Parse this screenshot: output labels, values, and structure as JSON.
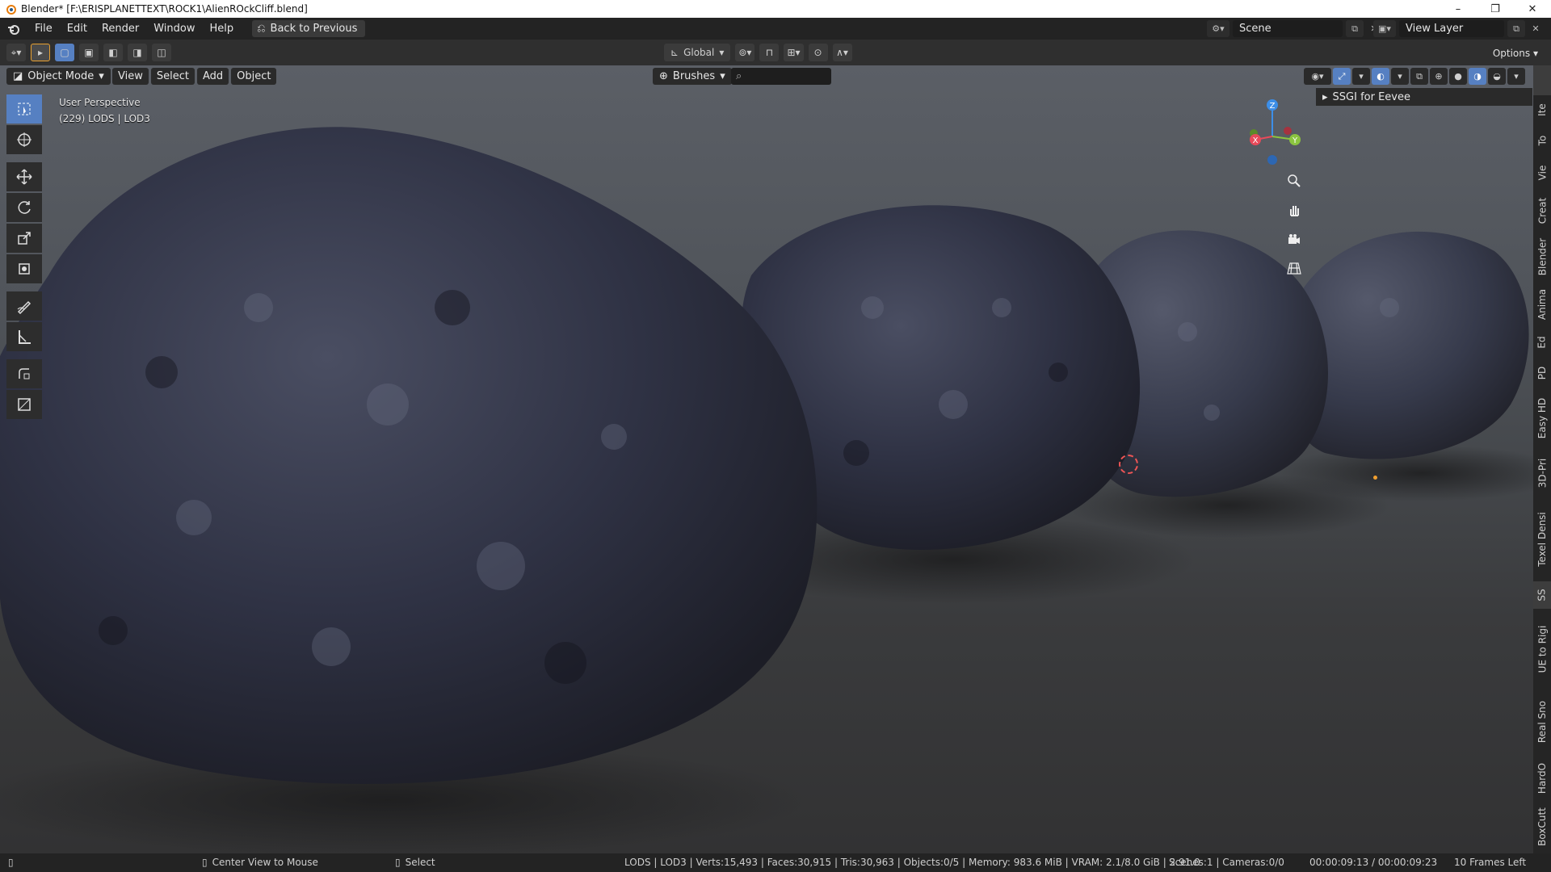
{
  "window": {
    "title": "Blender* [F:\\ERISPLANETTEXT\\ROCK1\\AlienROckCliff.blend]",
    "controls": [
      "–",
      "❐",
      "✕"
    ]
  },
  "menubar": {
    "menus": [
      "File",
      "Edit",
      "Render",
      "Window",
      "Help"
    ],
    "back_button": "Back to Previous",
    "scene": "Scene",
    "view_layer": "View Layer"
  },
  "tool_header": {
    "orientation": "Global",
    "options": "Options"
  },
  "viewport": {
    "mode": "Object Mode",
    "menus": [
      "View",
      "Select",
      "Add",
      "Object"
    ],
    "brushes": "Brushes",
    "perspective": "User Perspective",
    "object_info": "(229) LODS | LOD3",
    "ssgi_panel": "SSGI for Eevee",
    "gizmo": {
      "x": "X",
      "y": "Y",
      "z": "Z"
    }
  },
  "sidebar_tabs": [
    "Ite",
    "To",
    "Vie",
    "Creat",
    "Blender",
    "Anima",
    "Ed",
    "PD",
    "Easy HD",
    "3D-Pri",
    "Texel Densi",
    "SS",
    "UE to Rigi",
    "Real Sno",
    "HardO",
    "BoxCutt"
  ],
  "statusbar": {
    "center_view": "Center View to Mouse",
    "select": "Select",
    "stats": "LODS | LOD3 | Verts:15,493 | Faces:30,915 | Tris:30,963 | Objects:0/5 | Memory: 983.6 MiB | VRAM: 2.1/8.0 GiB | 2.91.0",
    "scenes": "Scenes:1 | Cameras:0/0",
    "time": "00:00:09:13 / 00:00:09:23",
    "frames_left": "10 Frames Left"
  },
  "colors": {
    "accent": "#5680c2",
    "rock": "#2f3244",
    "axis_x": "#e84a5a",
    "axis_y": "#8bc43f",
    "axis_z": "#3c8ee8"
  }
}
